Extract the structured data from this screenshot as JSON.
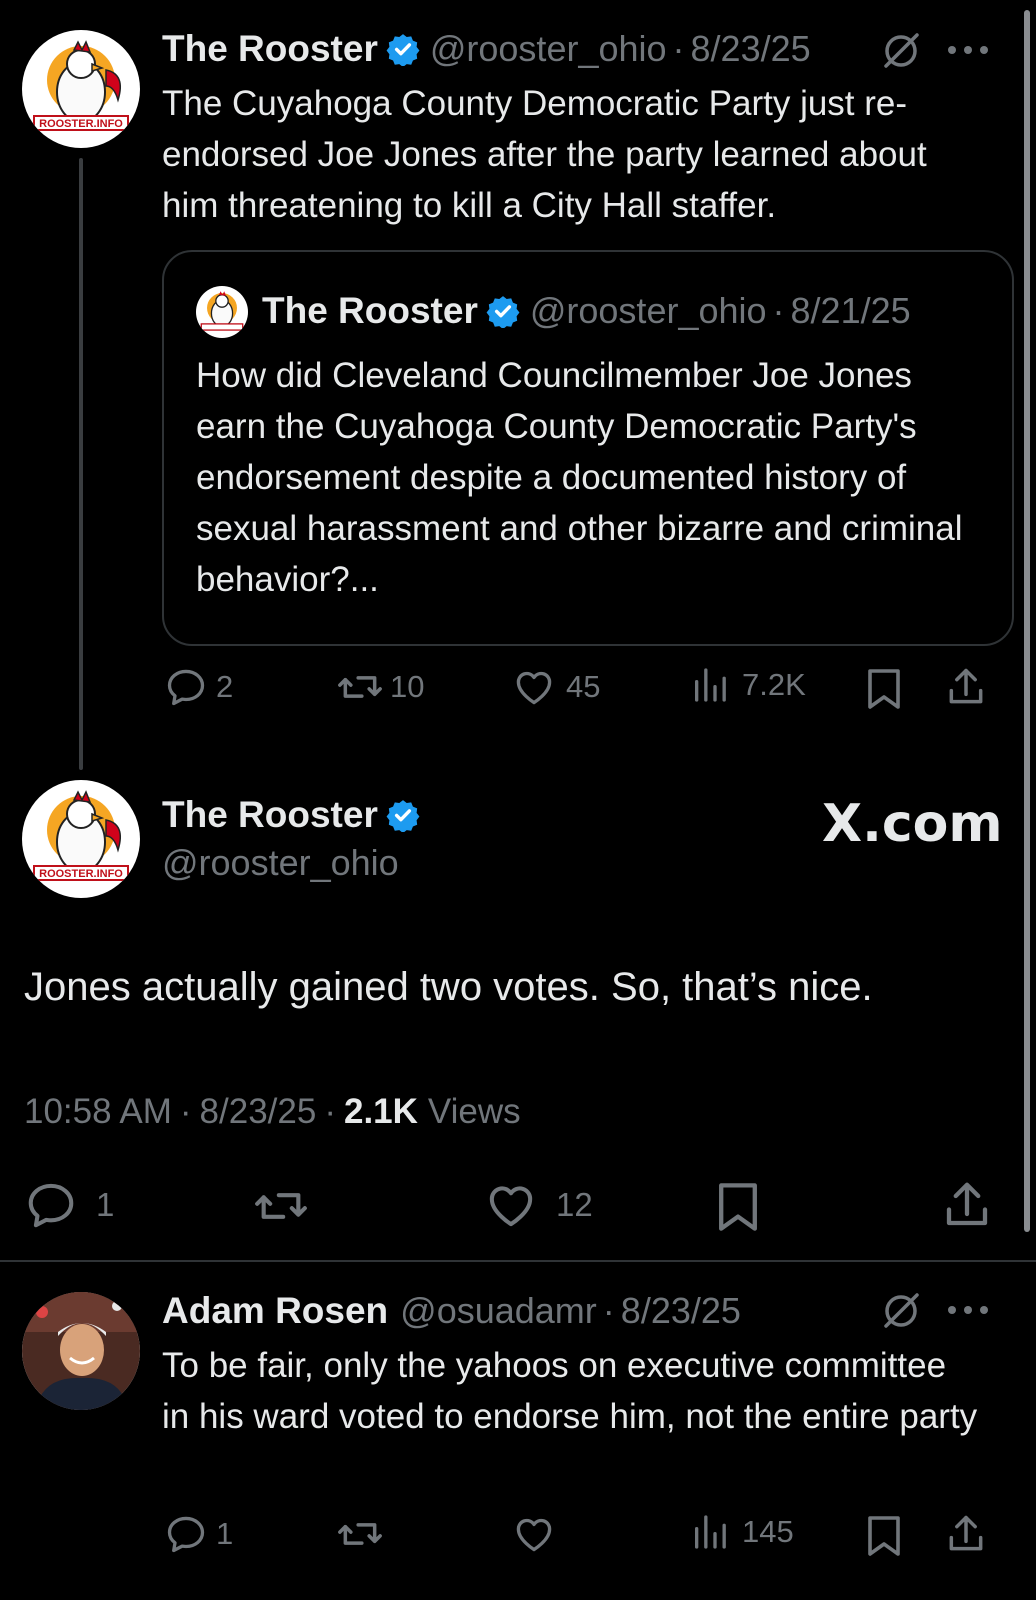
{
  "post1": {
    "author_name": "The Rooster",
    "handle": "@rooster_ohio",
    "date": "8/23/25",
    "separator": "·",
    "text": "The Cuyahoga County Democratic Party just re-endorsed Joe Jones after the party learned about him threatening to kill a City Hall staffer.",
    "quote": {
      "author_name": "The Rooster",
      "handle": "@rooster_ohio",
      "date": "8/21/25",
      "text": "How did Cleveland Councilmember Joe Jones earn the Cuyahoga County Democratic Party's endorsement despite a documented history of sexual harassment and other bizarre and criminal behavior?..."
    },
    "stats": {
      "replies": "2",
      "reposts": "10",
      "likes": "45",
      "views": "7.2K"
    }
  },
  "post2": {
    "author_name": "The Rooster",
    "handle": "@rooster_ohio",
    "watermark": "X.com",
    "text": "Jones actually gained two votes. So, that’s nice.",
    "time": "10:58 AM",
    "date": "8/23/25",
    "views_count": "2.1K",
    "views_label": "Views",
    "stats": {
      "replies": "1",
      "likes": "12"
    }
  },
  "post3": {
    "author_name": "Adam Rosen",
    "handle": "@osuadamr",
    "date": "8/23/25",
    "text": "To be fair, only the yahoos on executive committee in his ward voted to endorse him, not the entire party",
    "stats": {
      "replies": "1",
      "views": "145"
    }
  },
  "logo_text": "ROOSTER.INFO",
  "colors": {
    "background": "#000000",
    "text": "#e7e9ea",
    "muted": "#71767b",
    "verified": "#1d9bf0",
    "border": "#2f3336"
  }
}
